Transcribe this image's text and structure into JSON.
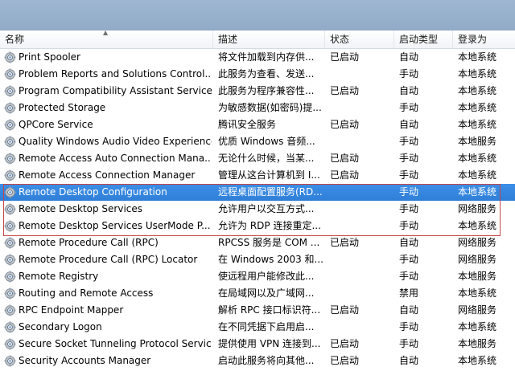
{
  "columns": {
    "name": "名称",
    "description": "描述",
    "status": "状态",
    "startup_type": "启动类型",
    "logon_as": "登录为"
  },
  "selected_index": 8,
  "highlight_rows": [
    8,
    9,
    10
  ],
  "services": [
    {
      "name": "Print Spooler",
      "description": "将文件加载到内存供...",
      "status": "已启动",
      "startup": "自动",
      "logon": "本地系统"
    },
    {
      "name": "Problem Reports and Solutions Control...",
      "description": "此服务为查看、发送...",
      "status": "",
      "startup": "手动",
      "logon": "本地系统"
    },
    {
      "name": "Program Compatibility Assistant Service",
      "description": "此服务为程序兼容性...",
      "status": "已启动",
      "startup": "自动",
      "logon": "本地系统"
    },
    {
      "name": "Protected Storage",
      "description": "为敏感数据(如密码)提...",
      "status": "",
      "startup": "手动",
      "logon": "本地系统"
    },
    {
      "name": "QPCore Service",
      "description": "腾讯安全服务",
      "status": "已启动",
      "startup": "自动",
      "logon": "本地系统"
    },
    {
      "name": "Quality Windows Audio Video Experience",
      "description": "优质 Windows 音频...",
      "status": "",
      "startup": "手动",
      "logon": "本地服务"
    },
    {
      "name": "Remote Access Auto Connection Mana...",
      "description": "无论什么时候，当某...",
      "status": "已启动",
      "startup": "手动",
      "logon": "本地系统"
    },
    {
      "name": "Remote Access Connection Manager",
      "description": "管理从这台计算机到 I...",
      "status": "已启动",
      "startup": "手动",
      "logon": "本地系统"
    },
    {
      "name": "Remote Desktop Configuration",
      "description": "远程桌面配置服务(RD...",
      "status": "",
      "startup": "手动",
      "logon": "本地系统"
    },
    {
      "name": "Remote Desktop Services",
      "description": "允许用户以交互方式...",
      "status": "",
      "startup": "手动",
      "logon": "网络服务"
    },
    {
      "name": "Remote Desktop Services UserMode P...",
      "description": "允许为 RDP 连接重定...",
      "status": "",
      "startup": "手动",
      "logon": "本地系统"
    },
    {
      "name": "Remote Procedure Call (RPC)",
      "description": "RPCSS 服务是 COM ...",
      "status": "已启动",
      "startup": "自动",
      "logon": "网络服务"
    },
    {
      "name": "Remote Procedure Call (RPC) Locator",
      "description": "在 Windows 2003 和...",
      "status": "",
      "startup": "手动",
      "logon": "网络服务"
    },
    {
      "name": "Remote Registry",
      "description": "使远程用户能修改此...",
      "status": "",
      "startup": "手动",
      "logon": "本地服务"
    },
    {
      "name": "Routing and Remote Access",
      "description": "在局域网以及广域网...",
      "status": "",
      "startup": "禁用",
      "logon": "本地系统"
    },
    {
      "name": "RPC Endpoint Mapper",
      "description": "解析 RPC 接口标识符...",
      "status": "已启动",
      "startup": "自动",
      "logon": "网络服务"
    },
    {
      "name": "Secondary Logon",
      "description": "在不同凭据下启用启...",
      "status": "",
      "startup": "手动",
      "logon": "本地系统"
    },
    {
      "name": "Secure Socket Tunneling Protocol Service",
      "description": "提供使用 VPN 连接到...",
      "status": "已启动",
      "startup": "手动",
      "logon": "本地服务"
    },
    {
      "name": "Security Accounts Manager",
      "description": "启动此服务将向其他...",
      "status": "已启动",
      "startup": "自动",
      "logon": "本地系统"
    }
  ]
}
